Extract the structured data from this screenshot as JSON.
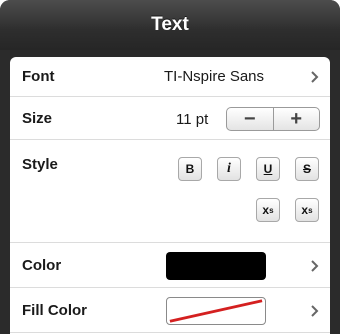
{
  "header": {
    "title": "Text"
  },
  "font": {
    "label": "Font",
    "value": "TI-Nspire Sans"
  },
  "size": {
    "label": "Size",
    "value": "11 pt",
    "minus": "−",
    "plus": "+"
  },
  "style": {
    "label": "Style",
    "bold": "B",
    "italic": "i",
    "underline": "U",
    "strikethrough": "S",
    "superscript": {
      "base": "x",
      "mark": "s"
    },
    "subscript": {
      "base": "x",
      "mark": "s"
    }
  },
  "color": {
    "label": "Color",
    "swatch": "#000000"
  },
  "fill_color": {
    "label": "Fill Color",
    "swatch": "none"
  }
}
